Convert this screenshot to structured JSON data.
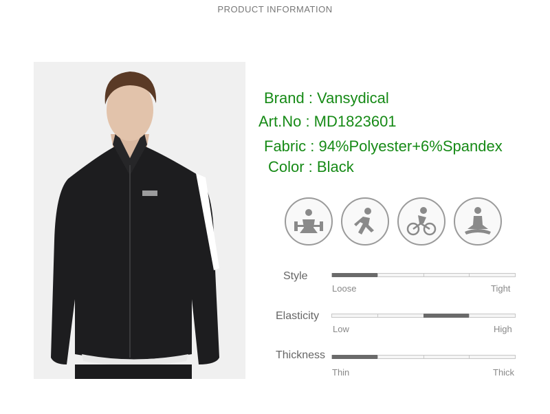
{
  "header": {
    "title": "PRODUCT INFORMATION"
  },
  "product": {
    "brand": "Brand : Vansydical",
    "art_no": "Art.No : MD1823601",
    "fabric": "Fabric : 94%Polyester+6%Spandex",
    "color": "Color : Black"
  },
  "activity_icons": [
    "weightlifting-icon",
    "running-icon",
    "cycling-icon",
    "yoga-icon"
  ],
  "scales": [
    {
      "label": "Style",
      "low": "Loose",
      "high": "Tight",
      "segment": 1,
      "segments": 5
    },
    {
      "label": "Elasticity",
      "low": "Low",
      "high": "High",
      "segment": 3,
      "segments": 5
    },
    {
      "label": "Thickness",
      "low": "Thin",
      "high": "Thick",
      "segment": 1,
      "segments": 5
    }
  ],
  "colors": {
    "text_green": "#168a16",
    "jacket": "#1b1b1d",
    "stripe": "#ffffff"
  }
}
